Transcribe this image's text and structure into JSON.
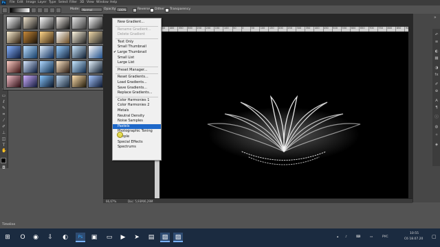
{
  "menubar": {
    "app_icon": "Ps",
    "items": [
      "File",
      "Edit",
      "Image",
      "Layer",
      "Type",
      "Select",
      "Filter",
      "3D",
      "View",
      "Window",
      "Help"
    ]
  },
  "options_bar": {
    "mode_label": "Mode:",
    "mode_value": "Normal",
    "opacity_label": "Opacity:",
    "opacity_value": "100%",
    "reverse_label": "Reverse",
    "dither_label": "Dither",
    "transparency_label": "Transparency",
    "reverse_checked": false,
    "dither_checked": true,
    "transparency_checked": true
  },
  "gradient_picker": {
    "gear_icon": "gear-icon",
    "swatches": [
      [
        "#ffffff",
        "#222222"
      ],
      [
        "#f2e6d0",
        "#1a1a1a"
      ],
      [
        "#ffffff",
        "#2a2a2a"
      ],
      [
        "#f5f0ea",
        "#101010"
      ],
      [
        "#e8e8e8",
        "#3a3a3a"
      ],
      [
        "#fafafa",
        "#1e1e1e"
      ],
      [
        "#fff3d6",
        "#2a1a0a"
      ],
      [
        "#c88a3a",
        "#1a1208"
      ],
      [
        "#ffd68a",
        "#3a2610"
      ],
      [
        "#ffffff",
        "#6a4a20"
      ],
      [
        "#fff7e0",
        "#222222"
      ],
      [
        "#f0d9a8",
        "#2a2a2a"
      ],
      [
        "#8ab4ff",
        "#0a1a3a"
      ],
      [
        "#bde0ff",
        "#123a66"
      ],
      [
        "#e0f0ff",
        "#0a2a5a"
      ],
      [
        "#9ad0ff",
        "#10203a"
      ],
      [
        "#cfeaff",
        "#0c1c30"
      ],
      [
        "#ffffff",
        "#1e4e8a"
      ],
      [
        "#ffd0c8",
        "#3a1010"
      ],
      [
        "#d8e8ff",
        "#0a1a3a"
      ],
      [
        "#b0d8ff",
        "#0a2a4a"
      ],
      [
        "#ffe8c8",
        "#2a1a10"
      ],
      [
        "#c8e8ff",
        "#102a4a"
      ],
      [
        "#e6f4ff",
        "#0c1a2c"
      ],
      [
        "#f4c0c8",
        "#2a0a10"
      ],
      [
        "#d0b0ff",
        "#101a3a"
      ],
      [
        "#8ac8ff",
        "#061226"
      ],
      [
        "#c0d8f0",
        "#18283a"
      ],
      [
        "#ffe0b0",
        "#221a0a"
      ],
      [
        "#a8c8ff",
        "#0a1630"
      ]
    ]
  },
  "dropdown_menu": {
    "items": [
      {
        "label": "New Gradient...",
        "disabled": false,
        "checked": false,
        "highlighted": false
      },
      {
        "separator": true
      },
      {
        "label": "Rename Gradient...",
        "disabled": true,
        "checked": false,
        "highlighted": false
      },
      {
        "label": "Delete Gradient",
        "disabled": true,
        "checked": false,
        "highlighted": false
      },
      {
        "separator": true
      },
      {
        "label": "Text Only",
        "disabled": false,
        "checked": false,
        "highlighted": false
      },
      {
        "label": "Small Thumbnail",
        "disabled": false,
        "checked": false,
        "highlighted": false
      },
      {
        "label": "Large Thumbnail",
        "disabled": false,
        "checked": true,
        "highlighted": false
      },
      {
        "label": "Small List",
        "disabled": false,
        "checked": false,
        "highlighted": false
      },
      {
        "label": "Large List",
        "disabled": false,
        "checked": false,
        "highlighted": false
      },
      {
        "separator": true
      },
      {
        "label": "Preset Manager...",
        "disabled": false,
        "checked": false,
        "highlighted": false
      },
      {
        "separator": true
      },
      {
        "label": "Reset Gradients...",
        "disabled": false,
        "checked": false,
        "highlighted": false
      },
      {
        "label": "Load Gradients...",
        "disabled": false,
        "checked": false,
        "highlighted": false
      },
      {
        "label": "Save Gradients...",
        "disabled": false,
        "checked": false,
        "highlighted": false
      },
      {
        "label": "Replace Gradients...",
        "disabled": false,
        "checked": false,
        "highlighted": false
      },
      {
        "separator": true
      },
      {
        "label": "Color Harmonies 1",
        "disabled": false,
        "checked": false,
        "highlighted": false
      },
      {
        "label": "Color Harmonies 2",
        "disabled": false,
        "checked": false,
        "highlighted": false
      },
      {
        "label": "Metals",
        "disabled": false,
        "checked": false,
        "highlighted": false
      },
      {
        "label": "Neutral Density",
        "disabled": false,
        "checked": false,
        "highlighted": false
      },
      {
        "label": "Noise Samples",
        "disabled": false,
        "checked": false,
        "highlighted": false
      },
      {
        "label": "Pastels",
        "disabled": false,
        "checked": false,
        "highlighted": true
      },
      {
        "label": "Photographic Toning",
        "disabled": false,
        "checked": false,
        "highlighted": false
      },
      {
        "label": "Simple",
        "disabled": false,
        "checked": false,
        "highlighted": false
      },
      {
        "label": "Special Effects",
        "disabled": false,
        "checked": false,
        "highlighted": false
      },
      {
        "label": "Spectrums",
        "disabled": false,
        "checked": false,
        "highlighted": false
      }
    ]
  },
  "ruler": {
    "numbers": [
      "450",
      "400",
      "350",
      "300",
      "250",
      "200",
      "150",
      "100",
      "50",
      "0",
      "50",
      "100",
      "150",
      "200",
      "250",
      "300",
      "350",
      "400",
      "450",
      "500",
      "550",
      "600",
      "650",
      "700",
      "750",
      "800",
      "850",
      "900"
    ]
  },
  "status_bar": {
    "zoom": "66,67%",
    "doc_info": "Doc: 5,93M/6,29M"
  },
  "timeline": {
    "label": "Timeline"
  },
  "taskbar": {
    "apps": [
      {
        "icon": "windows-start-icon",
        "glyph": "⊞"
      },
      {
        "icon": "opera-icon",
        "glyph": "O"
      },
      {
        "icon": "chrome-icon",
        "glyph": "◉"
      },
      {
        "icon": "download-icon",
        "glyph": "⇩"
      },
      {
        "icon": "firefox-icon",
        "glyph": "◐"
      },
      {
        "icon": "photoshop-icon",
        "glyph": "Ps"
      },
      {
        "icon": "ps-document-icon",
        "glyph": "▣"
      },
      {
        "icon": "folder-icon",
        "glyph": "▭"
      },
      {
        "icon": "video-icon",
        "glyph": "▶"
      },
      {
        "icon": "telegram-icon",
        "glyph": "➤"
      },
      {
        "icon": "window-icon",
        "glyph": "▤"
      },
      {
        "icon": "ps-image-icon",
        "glyph": "▨"
      },
      {
        "icon": "ps-image2-icon",
        "glyph": "▨"
      }
    ],
    "tray": {
      "language": "РУС",
      "time": "10:55",
      "date": "Сб 18.07.20"
    }
  }
}
